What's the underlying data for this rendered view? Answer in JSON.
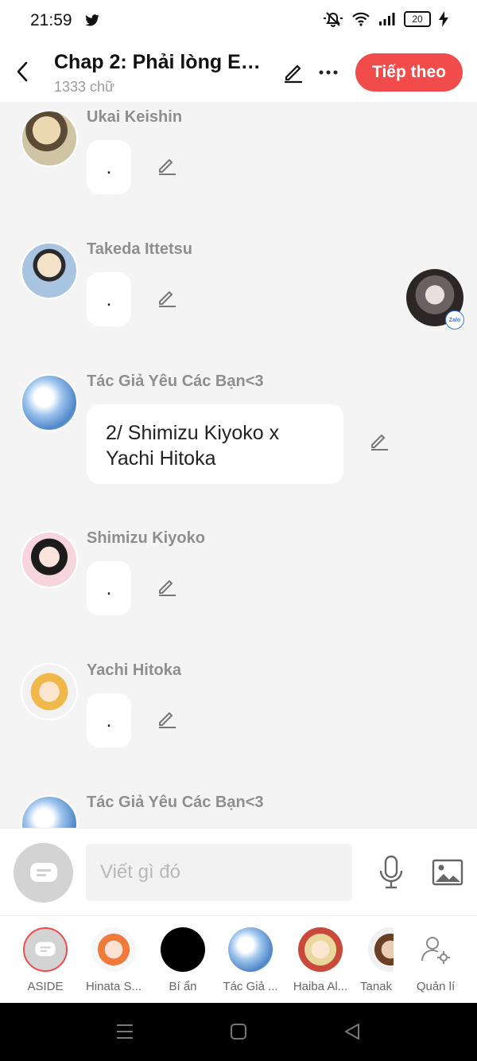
{
  "status_bar": {
    "time": "21:59",
    "battery": "20"
  },
  "header": {
    "title": "Chap 2: Phải lòng Em…",
    "subtitle": "1333 chữ",
    "next_label": "Tiếp theo"
  },
  "messages": [
    {
      "name": "Ukai Keishin",
      "text": "."
    },
    {
      "name": "Takeda Ittetsu",
      "text": "."
    },
    {
      "name": "Tác Giả Yêu Các Bạn<3",
      "text": "2/ Shimizu Kiyoko x Yachi Hitoka"
    },
    {
      "name": "Shimizu Kiyoko",
      "text": "."
    },
    {
      "name": "Yachi Hitoka",
      "text": "."
    },
    {
      "name": "Tác Giả Yêu Các Bạn<3",
      "text": ""
    }
  ],
  "floating_badge": "Zalo",
  "composer": {
    "placeholder": "Viết gì đó"
  },
  "characters": [
    {
      "label": "ASIDE"
    },
    {
      "label": "Hinata S..."
    },
    {
      "label": "Bí ẩn"
    },
    {
      "label": "Tác Giả ..."
    },
    {
      "label": "Haiba Al..."
    },
    {
      "label": "Tanak"
    },
    {
      "label": "Quản lí"
    }
  ],
  "colors": {
    "accent": "#f24b4b",
    "background": "#f4f4f4",
    "name_text": "#8e8e8e"
  }
}
